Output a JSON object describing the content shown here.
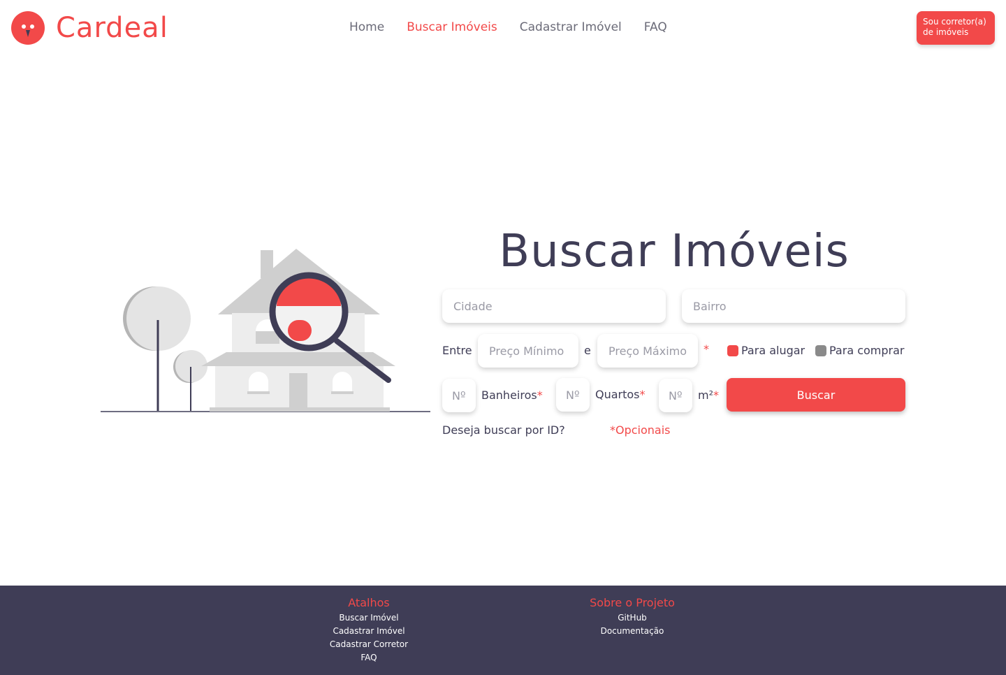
{
  "brand": {
    "name": "Cardeal",
    "accent_color": "#f24949",
    "dark_color": "#3f3d56"
  },
  "nav": {
    "items": [
      {
        "label": "Home"
      },
      {
        "label": "Buscar Imóveis",
        "active": true
      },
      {
        "label": "Cadastrar Imóvel"
      },
      {
        "label": "FAQ"
      }
    ]
  },
  "broker_button": {
    "label": "Sou corretor(a) de imóveis"
  },
  "search": {
    "title": "Buscar Imóveis",
    "city_placeholder": "Cidade",
    "neighborhood_placeholder": "Bairro",
    "between_label": "Entre",
    "and_label": "e",
    "min_price_placeholder": "Preço Mínimo",
    "max_price_placeholder": "Preço Máximo",
    "required_marker": "*",
    "rent_label": "Para alugar",
    "rent_checked": true,
    "buy_label": "Para comprar",
    "buy_checked": false,
    "number_placeholder": "Nº",
    "bathrooms_label": "Banheiros",
    "bedrooms_label": "Quartos",
    "area_label": "m²",
    "search_button": "Buscar",
    "search_by_id_link": "Deseja buscar por ID?",
    "optional_note": "*Opcionais"
  },
  "footer": {
    "shortcuts": {
      "title": "Atalhos",
      "links": [
        "Buscar Imóvel",
        "Cadastrar Imóvel",
        "Cadastrar Corretor",
        "FAQ"
      ]
    },
    "about": {
      "title": "Sobre o Projeto",
      "links": [
        "GitHub",
        "Documentação"
      ]
    }
  }
}
